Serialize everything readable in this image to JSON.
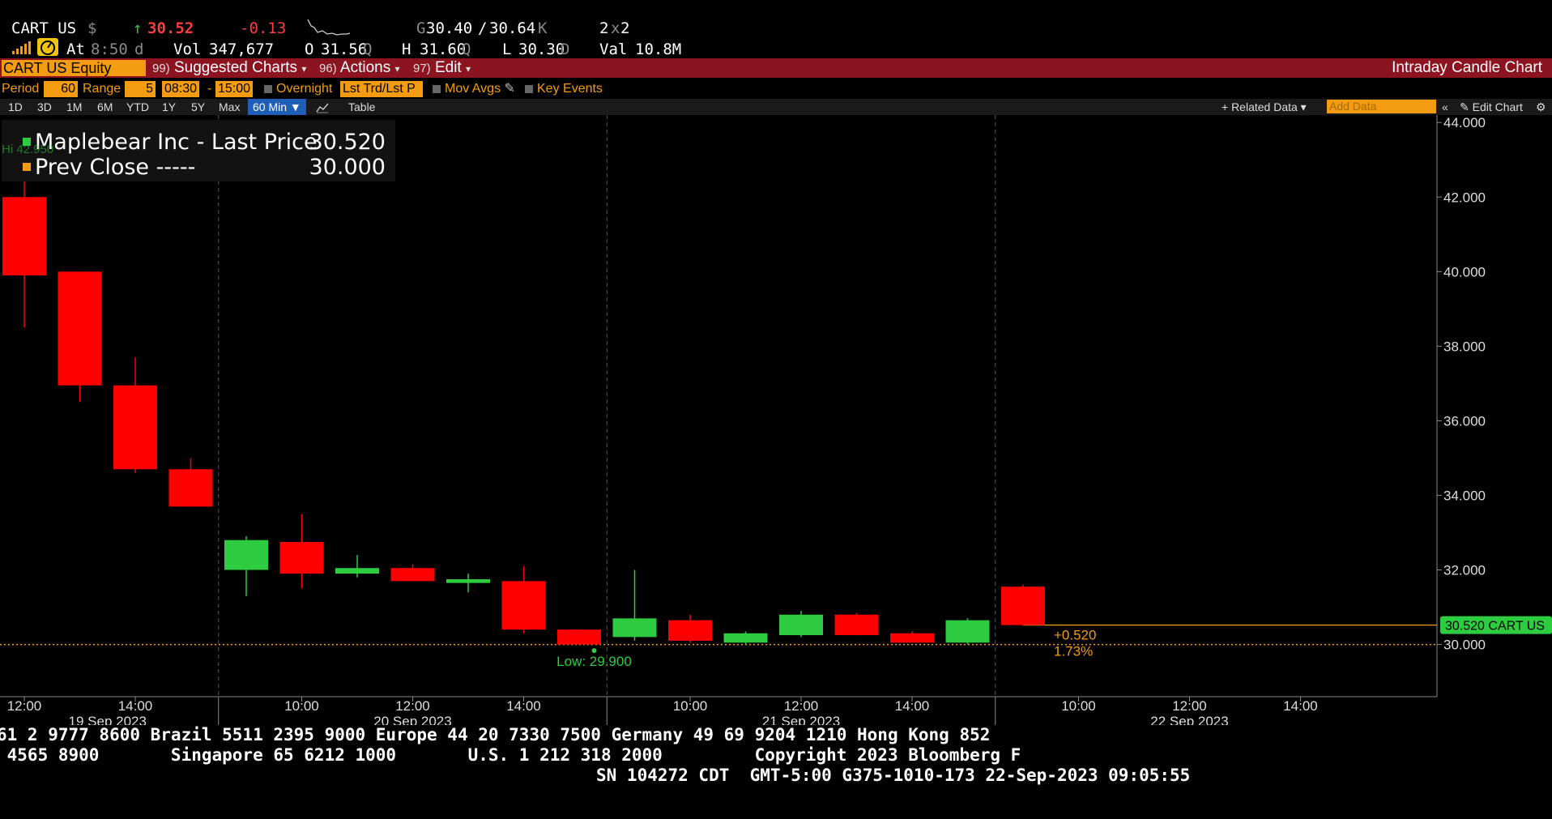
{
  "quote": {
    "ticker": "CART US",
    "currency": "$",
    "arrow": "↑",
    "last": "30.52",
    "change": "-0.13",
    "bid_prefix": "G",
    "bid": "30.40",
    "ask": "30.64",
    "ask_suffix": "K",
    "size": "2",
    "size_x": "x",
    "size2": "2",
    "at_label": "At",
    "time": "8:50",
    "time_suffix": "d",
    "vol_label": "Vol",
    "volume": "347,677",
    "open_label": "O",
    "open": "31.56",
    "open_suffix": "Q",
    "high_label": "H",
    "high": "31.60",
    "high_suffix": "Q",
    "low_label": "L",
    "low": "30.30",
    "low_suffix": "D",
    "val_label": "Val",
    "value": "10.8M"
  },
  "menubar": {
    "security": "CART US Equity",
    "suggested_num": "99)",
    "suggested": "Suggested Charts",
    "actions_num": "96)",
    "actions": "Actions",
    "edit_num": "97)",
    "edit": "Edit",
    "title": "Intraday Candle Chart"
  },
  "settings": {
    "period_label": "Period",
    "period": "60",
    "range_label": "Range",
    "range": "5",
    "start": "08:30",
    "dash": "-",
    "end": "15:00",
    "overnight": "Overnight",
    "trade_type": "Lst Trd/Lst P",
    "mov_avgs": "Mov Avgs",
    "key_events": "Key Events"
  },
  "rangebar": {
    "buttons": [
      "1D",
      "3D",
      "1M",
      "6M",
      "YTD",
      "1Y",
      "5Y",
      "Max"
    ],
    "interval": "60 Min ▼",
    "table": "Table",
    "related": "+ Related Data ▾",
    "add_data": "Add Data",
    "collapse": "«",
    "edit_chart": "✎ Edit Chart",
    "settings_icon": "gear-icon"
  },
  "chart_data": {
    "type": "candlestick",
    "legend": [
      {
        "name": "Maplebear Inc - Last Price",
        "value": "30.520",
        "color": "#2ecc40"
      },
      {
        "name": "Prev Close -----",
        "value": "30.000",
        "color": "#f39c12"
      }
    ],
    "high_label": "Hi 42.950",
    "low_label": "Low: 29.900",
    "last_tag": "30.520 CART US",
    "change_abs": "+0.520",
    "change_pct": "1.73%",
    "prev_close": 30.0,
    "last_price": 30.52,
    "ylim": [
      28.6,
      44.2
    ],
    "yticks": [
      "44.000",
      "42.000",
      "40.000",
      "38.000",
      "36.000",
      "34.000",
      "32.000",
      "30.000"
    ],
    "ytick_values": [
      44,
      42,
      40,
      38,
      36,
      34,
      32,
      30
    ],
    "xticks": [
      {
        "i": 0,
        "label": "12:00"
      },
      {
        "i": 2,
        "label": "14:00"
      },
      {
        "i": 5,
        "label": "10:00"
      },
      {
        "i": 7,
        "label": "12:00"
      },
      {
        "i": 9,
        "label": "14:00"
      },
      {
        "i": 12,
        "label": "10:00"
      },
      {
        "i": 14,
        "label": "12:00"
      },
      {
        "i": 16,
        "label": "14:00"
      },
      {
        "i": 19,
        "label": "10:00"
      },
      {
        "i": 21,
        "label": "12:00"
      },
      {
        "i": 23,
        "label": "14:00"
      }
    ],
    "day_labels": [
      {
        "i": 1.5,
        "label": "19 Sep 2023"
      },
      {
        "i": 7,
        "label": "20 Sep 2023"
      },
      {
        "i": 14,
        "label": "21 Sep 2023"
      },
      {
        "i": 21,
        "label": "22 Sep 2023"
      }
    ],
    "day_separators": [
      3.5,
      10.5,
      17.5
    ],
    "candles": [
      {
        "o": 42.0,
        "h": 42.95,
        "l": 38.5,
        "c": 39.9
      },
      {
        "o": 40.0,
        "h": 40.0,
        "l": 36.5,
        "c": 36.95
      },
      {
        "o": 36.95,
        "h": 37.7,
        "l": 34.6,
        "c": 34.7
      },
      {
        "o": 34.7,
        "h": 35.0,
        "l": 33.7,
        "c": 33.7
      },
      {
        "o": 32.0,
        "h": 32.9,
        "l": 31.3,
        "c": 32.8
      },
      {
        "o": 32.75,
        "h": 33.5,
        "l": 31.5,
        "c": 31.9
      },
      {
        "o": 31.9,
        "h": 32.4,
        "l": 31.8,
        "c": 32.05
      },
      {
        "o": 32.05,
        "h": 32.15,
        "l": 31.7,
        "c": 31.7
      },
      {
        "o": 31.65,
        "h": 31.9,
        "l": 31.4,
        "c": 31.75
      },
      {
        "o": 31.7,
        "h": 32.1,
        "l": 30.3,
        "c": 30.4
      },
      {
        "o": 30.4,
        "h": 30.4,
        "l": 30.0,
        "c": 30.0
      },
      {
        "o": 30.2,
        "h": 32.0,
        "l": 30.1,
        "c": 30.7
      },
      {
        "o": 30.65,
        "h": 30.8,
        "l": 30.05,
        "c": 30.1
      },
      {
        "o": 30.05,
        "h": 30.35,
        "l": 30.0,
        "c": 30.3
      },
      {
        "o": 30.25,
        "h": 30.9,
        "l": 30.2,
        "c": 30.8
      },
      {
        "o": 30.8,
        "h": 30.85,
        "l": 30.25,
        "c": 30.25
      },
      {
        "o": 30.3,
        "h": 30.35,
        "l": 30.05,
        "c": 30.05
      },
      {
        "o": 30.05,
        "h": 30.7,
        "l": 30.0,
        "c": 30.65
      },
      {
        "o": 31.55,
        "h": 31.6,
        "l": 30.5,
        "c": 30.52
      }
    ],
    "colors": {
      "up": "#2ecc40",
      "down": "#ff0000",
      "prev_close": "#f39c12",
      "grid": "#555555",
      "axis": "#888888"
    }
  },
  "footer": {
    "line1": "61 2 9777 8600 Brazil 5511 2395 9000 Europe 44 20 7330 7500 Germany 49 69 9204 1210 Hong Kong 852",
    "line2": " 4565 8900       Singapore 65 6212 1000       U.S. 1 212 318 2000         Copyright 2023 Bloomberg F",
    "line3": "SN 104272 CDT  GMT-5:00 G375-1010-173 22-Sep-2023 09:05:55"
  }
}
